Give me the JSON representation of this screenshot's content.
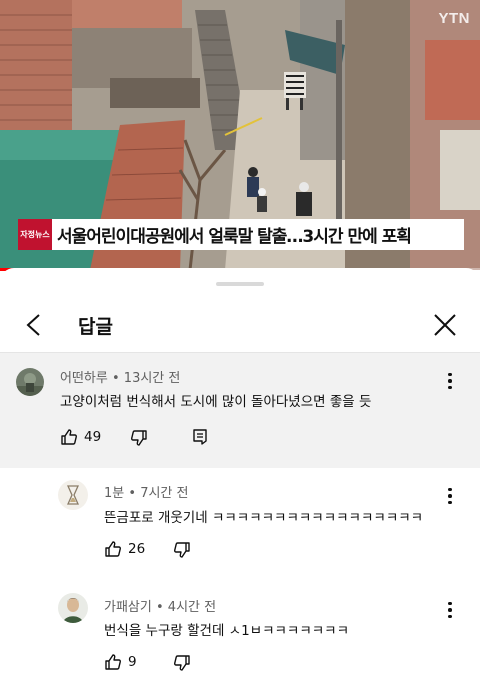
{
  "video": {
    "channel_logo": "YTN",
    "caption_badge": "자정뉴스",
    "caption": "서울어린이대공원에서 얼룩말 탈출…3시간 만에 포획",
    "progress": 0.64
  },
  "sheet": {
    "title": "답글",
    "back_icon": "chevron-left-icon",
    "close_icon": "close-icon"
  },
  "parent_comment": {
    "author": "어떤하루",
    "time": "13시간 전",
    "text": "고양이처럼 번식해서 도시에 많이 돌아다녔으면 좋을 듯",
    "likes": "49"
  },
  "replies": [
    {
      "author": "1분",
      "time": "7시간 전",
      "text": "뜬금포로 개웃기네 ㅋㅋㅋㅋㅋㅋㅋㅋㅋㅋㅋㅋㅋㅋㅋㅋㅋ",
      "likes": "26"
    },
    {
      "author": "가패삼기",
      "time": "4시간 전",
      "text": "번식을 누구랑 할건데 ㅅ1ㅂㅋㅋㅋㅋㅋㅋㅋ",
      "likes": "9"
    }
  ],
  "colors": {
    "accent": "#ff0000",
    "badge": "#c0122f",
    "highlight_bg": "#f2f2f2"
  }
}
